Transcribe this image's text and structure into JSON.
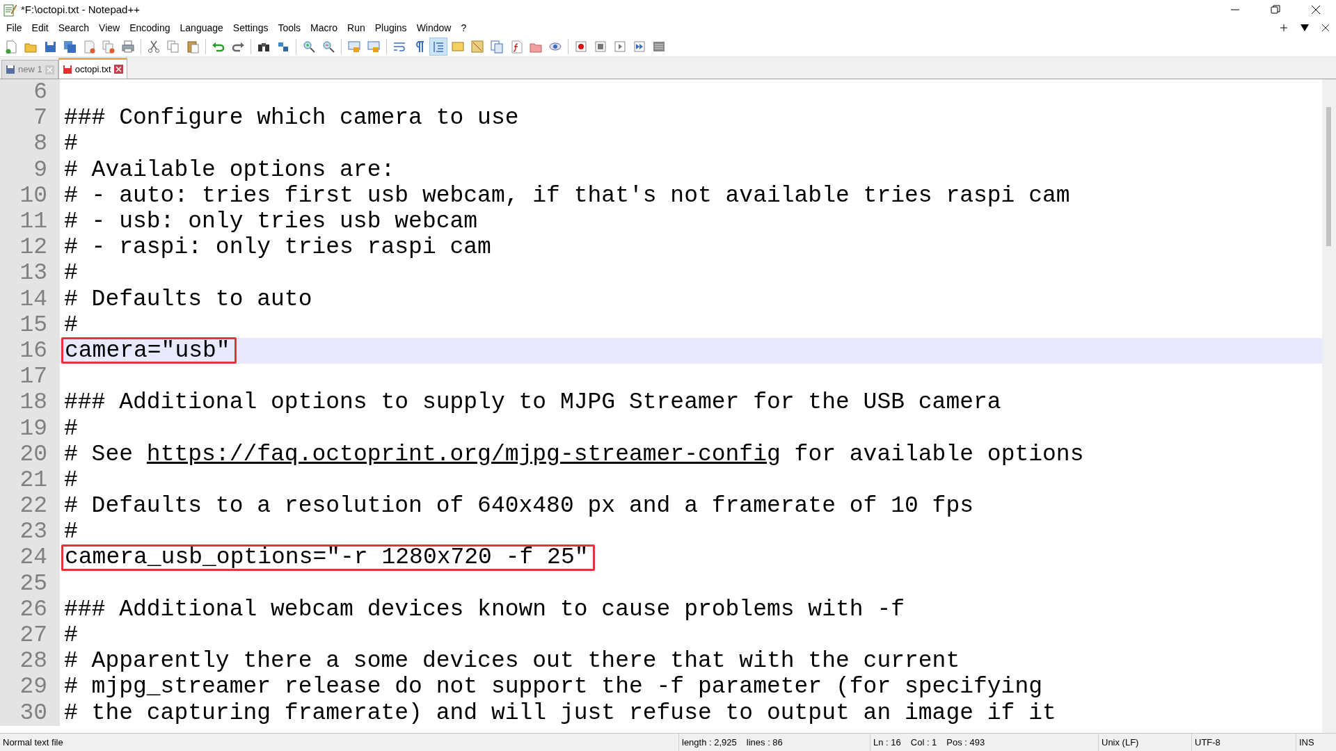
{
  "window": {
    "title": "*F:\\octopi.txt - Notepad++"
  },
  "menu": [
    "File",
    "Edit",
    "Search",
    "View",
    "Encoding",
    "Language",
    "Settings",
    "Tools",
    "Macro",
    "Run",
    "Plugins",
    "Window",
    "?"
  ],
  "tabs": [
    {
      "label": "new 1",
      "selected": false
    },
    {
      "label": "octopi.txt",
      "selected": true
    }
  ],
  "editor": {
    "lines": [
      {
        "number": "6",
        "current": false,
        "boxed": false
      },
      {
        "number": "7",
        "segments": [
          {
            "text": "### Configure which camera to use"
          }
        ],
        "current": false,
        "boxed": false
      },
      {
        "number": "8",
        "segments": [
          {
            "text": "#"
          }
        ],
        "current": false,
        "boxed": false
      },
      {
        "number": "9",
        "segments": [
          {
            "text": "# Available options are:"
          }
        ],
        "current": false,
        "boxed": false
      },
      {
        "number": "10",
        "segments": [
          {
            "text": "# - auto: tries first usb webcam, if that's not available tries raspi cam"
          }
        ],
        "current": false,
        "boxed": false
      },
      {
        "number": "11",
        "segments": [
          {
            "text": "# - usb: only tries usb webcam"
          }
        ],
        "current": false,
        "boxed": false
      },
      {
        "number": "12",
        "segments": [
          {
            "text": "# - raspi: only tries raspi cam"
          }
        ],
        "current": false,
        "boxed": false
      },
      {
        "number": "13",
        "segments": [
          {
            "text": "#"
          }
        ],
        "current": false,
        "boxed": false
      },
      {
        "number": "14",
        "segments": [
          {
            "text": "# Defaults to auto"
          }
        ],
        "current": false,
        "boxed": false
      },
      {
        "number": "15",
        "segments": [
          {
            "text": "#"
          }
        ],
        "current": false,
        "boxed": false
      },
      {
        "number": "16",
        "segments": [
          {
            "text": "camera=\"usb\""
          }
        ],
        "current": true,
        "boxed": true
      },
      {
        "number": "17",
        "current": false,
        "boxed": false
      },
      {
        "number": "18",
        "segments": [
          {
            "text": "### Additional options to supply to MJPG Streamer for the USB camera"
          }
        ],
        "current": false,
        "boxed": false
      },
      {
        "number": "19",
        "segments": [
          {
            "text": "#"
          }
        ],
        "current": false,
        "boxed": false
      },
      {
        "number": "20",
        "segments": [
          {
            "text": "# See "
          },
          {
            "text": "https://faq.octoprint.org/mjpg-streamer-config",
            "link": true
          },
          {
            "text": " for available options"
          }
        ],
        "current": false,
        "boxed": false
      },
      {
        "number": "21",
        "segments": [
          {
            "text": "#"
          }
        ],
        "current": false,
        "boxed": false
      },
      {
        "number": "22",
        "segments": [
          {
            "text": "# Defaults to a resolution of 640x480 px and a framerate of 10 fps"
          }
        ],
        "current": false,
        "boxed": false
      },
      {
        "number": "23",
        "segments": [
          {
            "text": "#"
          }
        ],
        "current": false,
        "boxed": false
      },
      {
        "number": "24",
        "segments": [
          {
            "text": "camera_usb_options=\"-r 1280x720 -f 25\""
          }
        ],
        "current": false,
        "boxed": true
      },
      {
        "number": "25",
        "current": false,
        "boxed": false
      },
      {
        "number": "26",
        "segments": [
          {
            "text": "### Additional webcam devices known to cause problems with -f"
          }
        ],
        "current": false,
        "boxed": false
      },
      {
        "number": "27",
        "segments": [
          {
            "text": "#"
          }
        ],
        "current": false,
        "boxed": false
      },
      {
        "number": "28",
        "segments": [
          {
            "text": "# Apparently there a some devices out there that with the current"
          }
        ],
        "current": false,
        "boxed": false
      },
      {
        "number": "29",
        "segments": [
          {
            "text": "# mjpg_streamer release do not support the -f parameter (for specifying"
          }
        ],
        "current": false,
        "boxed": false
      },
      {
        "number": "30",
        "segments": [
          {
            "text": "# the capturing framerate) and will just refuse to output an image if it"
          }
        ],
        "current": false,
        "boxed": false
      }
    ]
  },
  "status_bar": [
    {
      "kind": "type",
      "text": "Normal text file"
    },
    {
      "kind": "length",
      "text": "length : 2,925"
    },
    {
      "kind": "lines",
      "text": "lines : 86"
    },
    {
      "kind": "ln",
      "text": "Ln : 16"
    },
    {
      "kind": "col",
      "text": "Col : 1"
    },
    {
      "kind": "pos",
      "text": "Pos : 493"
    },
    {
      "kind": "eol",
      "text": "Unix (LF)"
    },
    {
      "kind": "encoding",
      "text": "UTF-8"
    },
    {
      "kind": "mode",
      "text": "INS"
    }
  ]
}
